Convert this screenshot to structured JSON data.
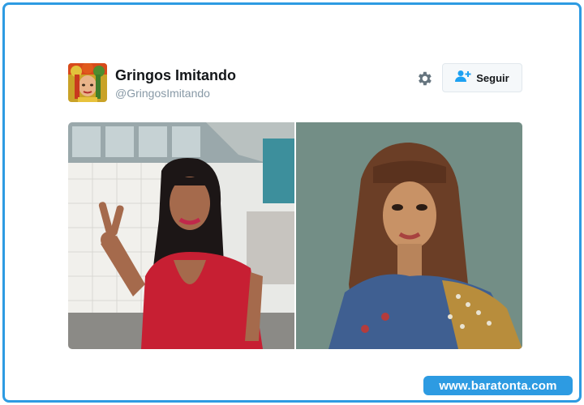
{
  "tweet": {
    "display_name": "Gringos Imitando",
    "handle": "@GringosImitando",
    "follow_label": "Seguir",
    "settings_icon": "gear-icon",
    "follow_icon": "add-user-icon",
    "accent_color": "#1da1f2"
  },
  "media": {
    "photos": [
      {
        "name": "photo-left"
      },
      {
        "name": "photo-right"
      }
    ]
  },
  "watermark": {
    "text": "www.baratonta.com",
    "color": "#2d9be2"
  }
}
